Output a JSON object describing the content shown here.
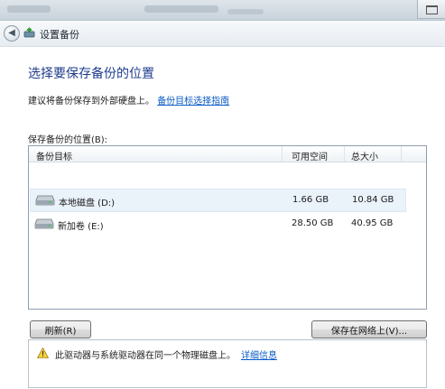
{
  "window": {
    "title": "设置备份"
  },
  "page": {
    "heading": "选择要保存备份的位置",
    "intro_text": "建议将备份保存到外部硬盘上。",
    "intro_link": "备份目标选择指南",
    "list_label": "保存备份的位置(B):"
  },
  "table": {
    "columns": [
      "备份目标",
      "可用空间",
      "总大小"
    ],
    "rows": [
      {
        "name": "本地磁盘 (D:)",
        "free": "1.66 GB",
        "total": "10.84 GB",
        "icon": "hard-drive-icon",
        "selected": true
      },
      {
        "name": "新加卷 (E:)",
        "free": "28.50 GB",
        "total": "40.95 GB",
        "icon": "hard-drive-icon",
        "selected": false
      }
    ]
  },
  "buttons": {
    "refresh": "刷新(R)",
    "save_network": "保存在网络上(V)..."
  },
  "warning": {
    "text": "此驱动器与系统驱动器在同一个物理磁盘上。",
    "link": "详细信息",
    "icon": "warning-icon"
  },
  "colors": {
    "heading": "#1e3c8c",
    "link": "#0a5bc4",
    "selected_row": "#eaf2fa"
  }
}
